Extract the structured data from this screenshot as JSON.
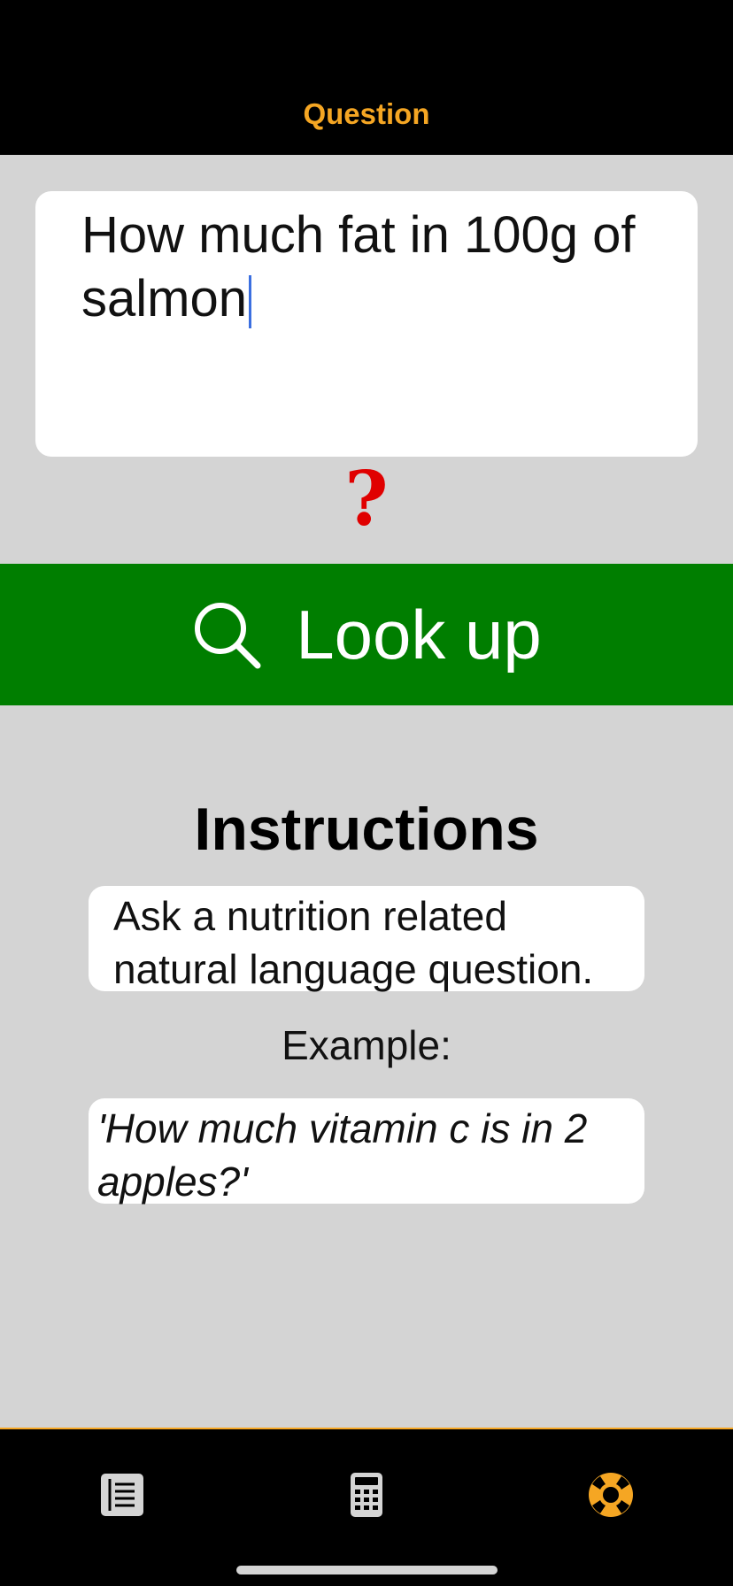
{
  "nav": {
    "title": "Question"
  },
  "question": {
    "value": "How much fat in 100g of salmon"
  },
  "status": {
    "symbol": "?",
    "color": "#e00000"
  },
  "lookup_button": {
    "label": "Look up",
    "icon": "search-icon",
    "color": "#007e00"
  },
  "instructions": {
    "title": "Instructions",
    "text": "Ask a nutrition related natural language question.",
    "example_label": "Example:",
    "example_text": "'How much vitamin c is in 2 apples?'"
  },
  "tab_bar": {
    "accent": "#f5a623",
    "items": [
      {
        "icon": "list-icon",
        "selected": false
      },
      {
        "icon": "calculator-icon",
        "selected": false
      },
      {
        "icon": "lifebuoy-icon",
        "selected": true
      }
    ]
  }
}
